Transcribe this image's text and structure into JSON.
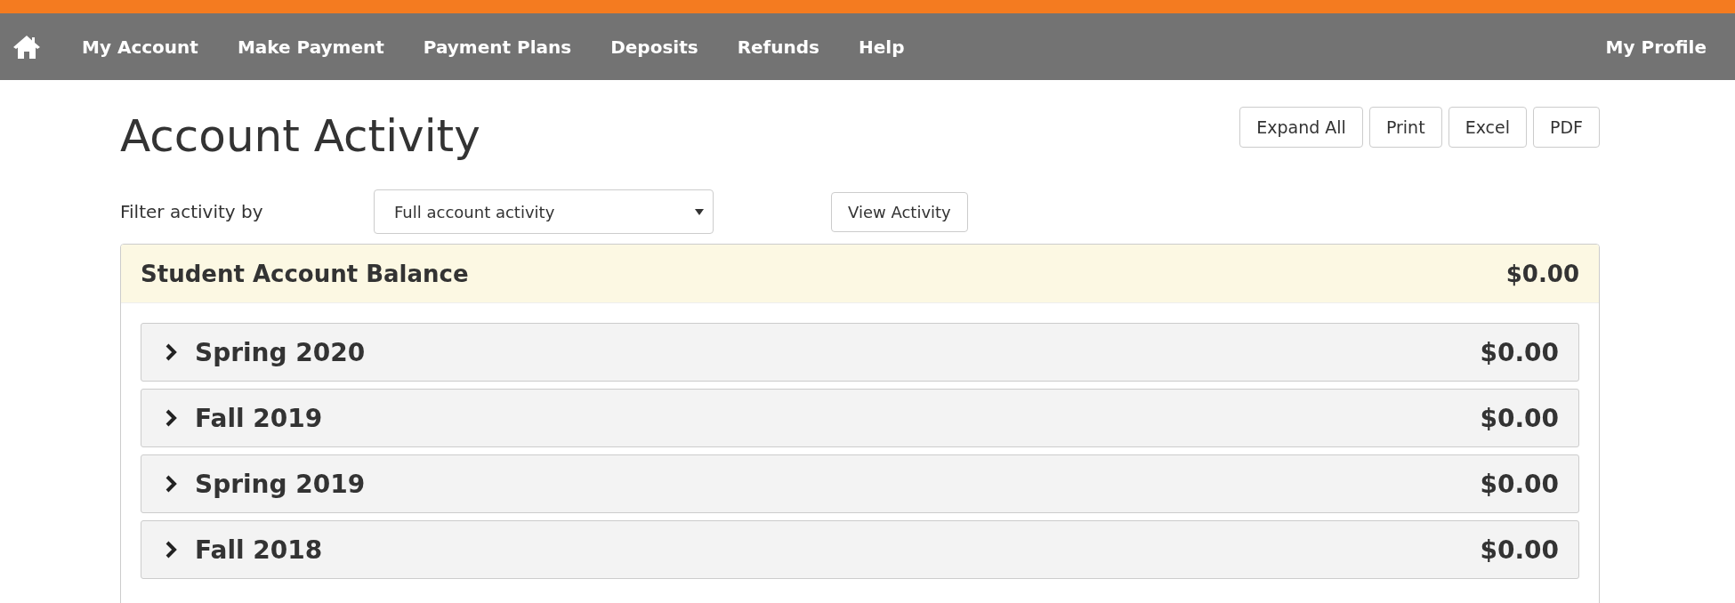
{
  "nav": {
    "items": [
      {
        "label": "My Account"
      },
      {
        "label": "Make Payment"
      },
      {
        "label": "Payment Plans"
      },
      {
        "label": "Deposits"
      },
      {
        "label": "Refunds"
      },
      {
        "label": "Help"
      }
    ],
    "profile": "My Profile"
  },
  "title": "Account Activity",
  "actions": [
    "Expand All",
    "Print",
    "Excel",
    "PDF"
  ],
  "filter": {
    "label": "Filter activity by",
    "value": "Full account activity",
    "button": "View Activity"
  },
  "balance": {
    "title": "Student Account Balance",
    "amount": "$0.00"
  },
  "terms": [
    {
      "name": "Spring 2020",
      "amount": "$0.00",
      "expanded": false
    },
    {
      "name": "Fall 2019",
      "amount": "$0.00",
      "expanded": false
    },
    {
      "name": "Spring 2019",
      "amount": "$0.00",
      "expanded": false
    },
    {
      "name": "Fall 2018",
      "amount": "$0.00",
      "expanded": false
    }
  ]
}
